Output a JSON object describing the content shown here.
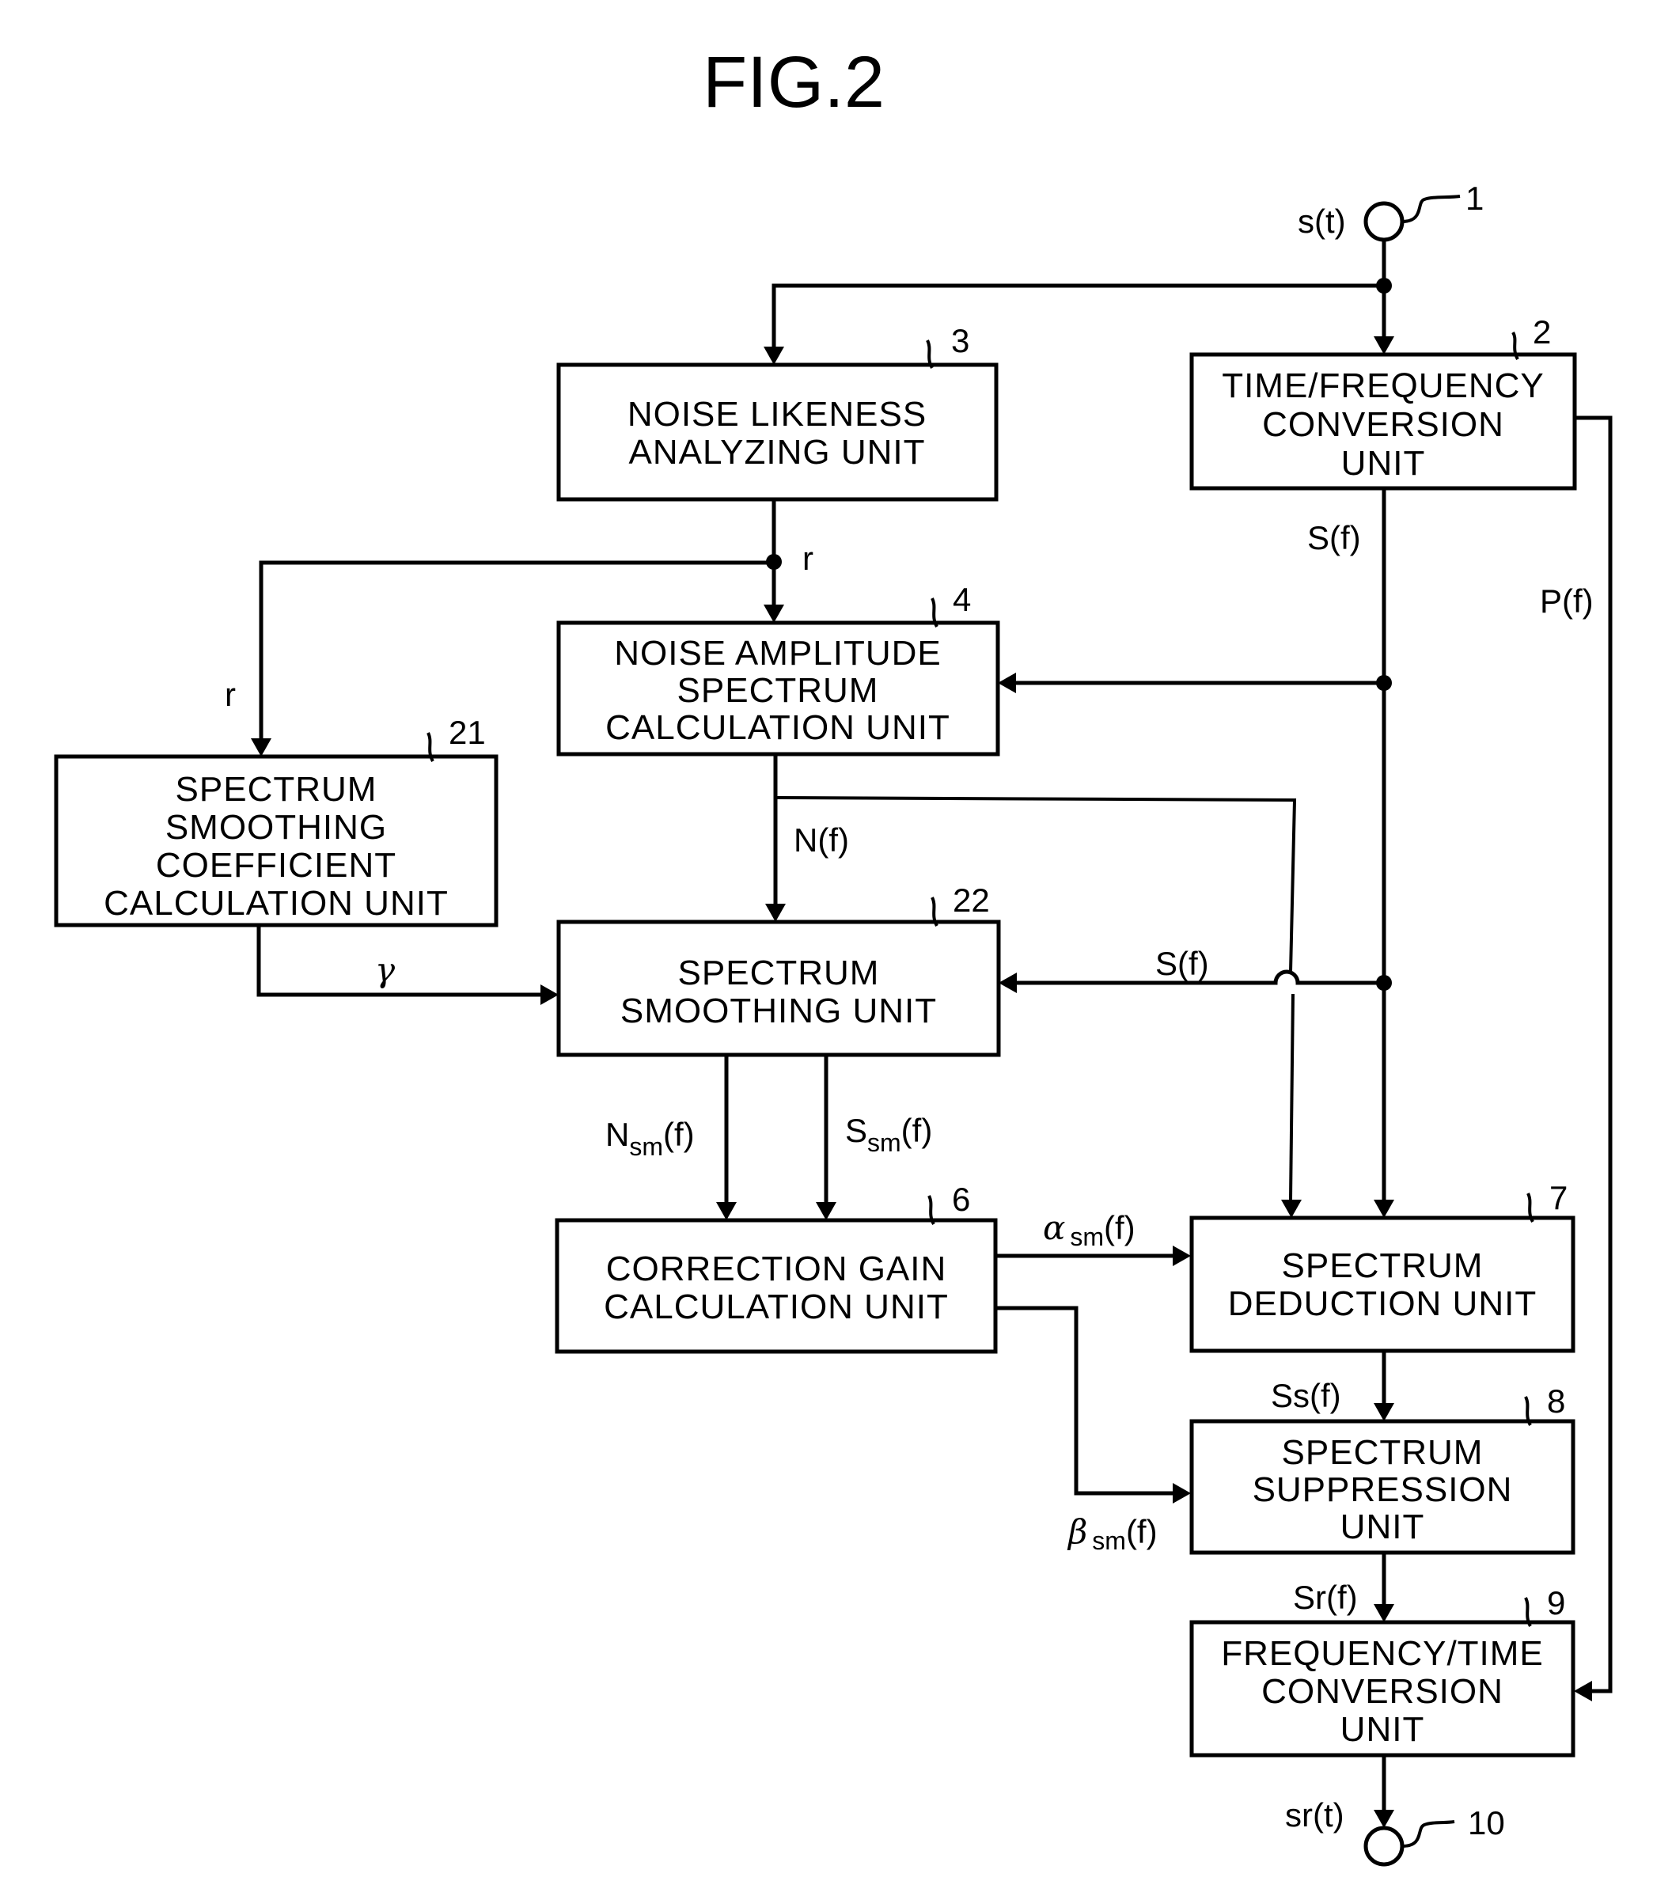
{
  "figure": {
    "title": "FIG.2"
  },
  "terminals": {
    "input": {
      "ref": "1",
      "signal": "s(t)"
    },
    "output": {
      "ref": "10",
      "signal": "sr(t)"
    }
  },
  "blocks": {
    "time_freq": {
      "ref": "2",
      "lines": [
        "TIME/FREQUENCY",
        "CONVERSION",
        "UNIT"
      ]
    },
    "noise_likeness": {
      "ref": "3",
      "lines": [
        "NOISE LIKENESS",
        "ANALYZING UNIT"
      ]
    },
    "noise_amplitude": {
      "ref": "4",
      "lines": [
        "NOISE AMPLITUDE",
        "SPECTRUM",
        "CALCULATION UNIT"
      ]
    },
    "smoothing_coeff": {
      "ref": "21",
      "lines": [
        "SPECTRUM",
        "SMOOTHING",
        "COEFFICIENT",
        "CALCULATION UNIT"
      ]
    },
    "smoothing": {
      "ref": "22",
      "lines": [
        "SPECTRUM",
        "SMOOTHING UNIT"
      ]
    },
    "correction_gain": {
      "ref": "6",
      "lines": [
        "CORRECTION GAIN",
        "CALCULATION UNIT"
      ]
    },
    "deduction": {
      "ref": "7",
      "lines": [
        "SPECTRUM",
        "DEDUCTION UNIT"
      ]
    },
    "suppression": {
      "ref": "8",
      "lines": [
        "SPECTRUM",
        "SUPPRESSION",
        "UNIT"
      ]
    },
    "freq_time": {
      "ref": "9",
      "lines": [
        "FREQUENCY/TIME",
        "CONVERSION",
        "UNIT"
      ]
    }
  },
  "signals": {
    "S_f_top": "S(f)",
    "P_f": "P(f)",
    "r_main": "r",
    "r_side": "r",
    "N_f": "N(f)",
    "gamma": "γ",
    "S_f_mid": "S(f)",
    "N_sm": {
      "base": "N",
      "sub": "sm",
      "tail": "(f)"
    },
    "S_sm": {
      "base": "S",
      "sub": "sm",
      "tail": "(f)"
    },
    "alpha_sm": {
      "base": "α",
      "sub": "sm",
      "tail": "(f)"
    },
    "beta_sm": {
      "base": "β",
      "sub": "sm",
      "tail": "(f)"
    },
    "Ss_f": "Ss(f)",
    "Sr_f": "Sr(f)"
  }
}
